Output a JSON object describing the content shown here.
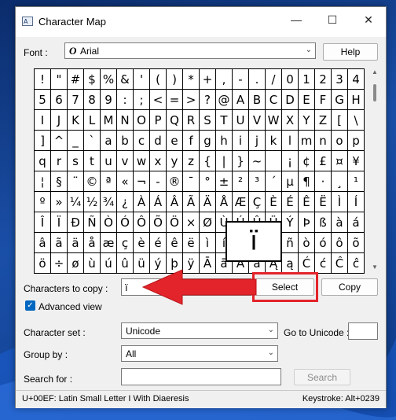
{
  "window": {
    "title": "Character Map"
  },
  "font": {
    "label": "Font :",
    "value": "Arial",
    "help_label": "Help"
  },
  "characters": [
    "!",
    "\"",
    "#",
    "$",
    "%",
    "&",
    "'",
    "(",
    ")",
    "*",
    "+",
    ",",
    "-",
    ".",
    "/",
    "0",
    "1",
    "2",
    "3",
    "4",
    "5",
    "6",
    "7",
    "8",
    "9",
    ":",
    ";",
    "<",
    "=",
    ">",
    "?",
    "@",
    "A",
    "B",
    "C",
    "D",
    "E",
    "F",
    "G",
    "H",
    "I",
    "J",
    "K",
    "L",
    "M",
    "N",
    "O",
    "P",
    "Q",
    "R",
    "S",
    "T",
    "U",
    "V",
    "W",
    "X",
    "Y",
    "Z",
    "[",
    "\\",
    "]",
    "^",
    "_",
    "`",
    "a",
    "b",
    "c",
    "d",
    "e",
    "f",
    "g",
    "h",
    "i",
    "j",
    "k",
    "l",
    "m",
    "n",
    "o",
    "p",
    "q",
    "r",
    "s",
    "t",
    "u",
    "v",
    "w",
    "x",
    "y",
    "z",
    "{",
    "|",
    "}",
    "~",
    " ",
    "¡",
    "¢",
    "£",
    "¤",
    "¥",
    "¦",
    "§",
    "¨",
    "©",
    "ª",
    "«",
    "¬",
    "-",
    "®",
    "¯",
    "°",
    "±",
    "²",
    "³",
    "´",
    "µ",
    "¶",
    "·",
    "¸",
    "¹",
    "º",
    "»",
    "¼",
    "½",
    "¾",
    "¿",
    "À",
    "Á",
    "Â",
    "Ã",
    "Ä",
    "Å",
    "Æ",
    "Ç",
    "È",
    "É",
    "Ê",
    "Ë",
    "Ì",
    "Í",
    "Î",
    "Ï",
    "Ð",
    "Ñ",
    "Ò",
    "Ó",
    "Ô",
    "Õ",
    "Ö",
    "×",
    "Ø",
    "Ù",
    "Ú",
    "Û",
    "Ü",
    "Ý",
    "Þ",
    "ß",
    "à",
    "á",
    "â",
    "ã",
    "ä",
    "å",
    "æ",
    "ç",
    "è",
    "é",
    "ê",
    "ë",
    "ì",
    "í",
    "î",
    "ï",
    "ð",
    "ñ",
    "ò",
    "ó",
    "ô",
    "õ",
    "ö",
    "÷",
    "ø",
    "ù",
    "ú",
    "û",
    "ü",
    "ý",
    "þ",
    "ÿ",
    "Ā",
    "ā",
    "Ă",
    "ă",
    "Ą",
    "ą",
    "Ć",
    "ć",
    "Ĉ",
    "ĉ"
  ],
  "selected_char_zoom": "ï",
  "copy": {
    "label": "Characters to copy :",
    "value": "ï",
    "select_label": "Select",
    "copy_label": "Copy"
  },
  "advanced_view": {
    "label": "Advanced view",
    "checked": true
  },
  "character_set": {
    "label": "Character set :",
    "value": "Unicode"
  },
  "go_to_unicode": {
    "label": "Go to Unicode :",
    "value": ""
  },
  "group_by": {
    "label": "Group by :",
    "value": "All"
  },
  "search": {
    "label": "Search for :",
    "value": "",
    "button_label": "Search"
  },
  "status": {
    "left": "U+00EF: Latin Small Letter I With Diaeresis",
    "right": "Keystroke: Alt+0239"
  },
  "colors": {
    "accent": "#0067c0",
    "annotation": "#e3242b"
  }
}
